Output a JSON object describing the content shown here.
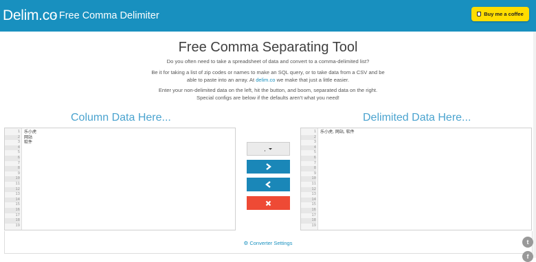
{
  "header": {
    "logo": "Delim.co",
    "tagline": "- Free Comma Delimiter",
    "coffee_label": "Buy me a coffee",
    "bar_color": "#1890bf",
    "coffee_color": "#ffdd00"
  },
  "main": {
    "title": "Free Comma Separating Tool",
    "intro": "Do you often need to take a spreadsheet of data and convert to a comma-delimited list?",
    "para2_before": "Be it for taking a list of zip codes or names to make an SQL query, or to take data from a CSV and be able to paste into an array. At ",
    "para2_link": "delim.co",
    "para2_after": " we make that just a little easier.",
    "para3": "Enter your non-delimited data on the left, hit the button, and boom, separated data on the right. Special configs are below if the defaults aren't what you need!"
  },
  "left": {
    "title": "Column Data Here...",
    "lines": [
      "乐小虎",
      "网站",
      "软件"
    ]
  },
  "right": {
    "title": "Delimited Data Here...",
    "lines": [
      "乐小虎, 网站, 软件"
    ]
  },
  "controls": {
    "delimiter_value": ",",
    "convert_icon": "chevron-right-icon",
    "revert_icon": "chevron-left-icon",
    "clear_icon": "times-icon"
  },
  "settings": {
    "label": "Converter Settings",
    "icon": "gear-icon"
  },
  "line_numbers": [
    "1",
    "2",
    "3",
    "4",
    "5",
    "6",
    "7",
    "8",
    "9",
    "10",
    "11",
    "12",
    "13",
    "14",
    "15",
    "16",
    "17",
    "18",
    "19"
  ]
}
